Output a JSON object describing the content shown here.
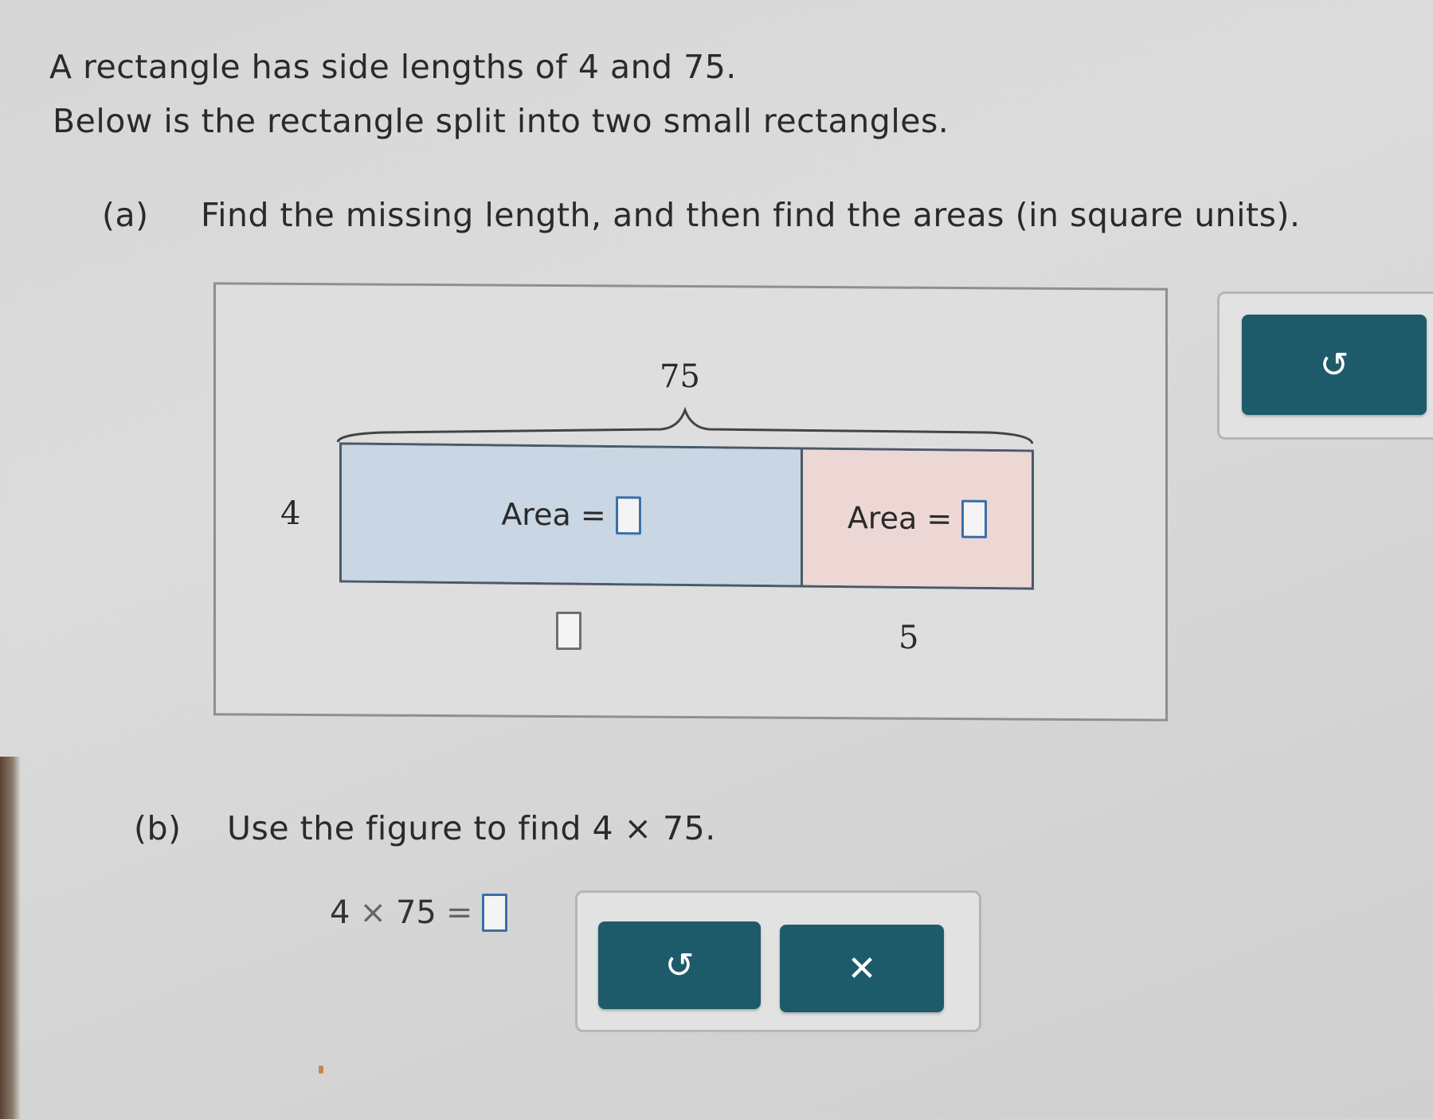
{
  "problem": {
    "line1": "A rectangle has side lengths of 4 and 75.",
    "line2": "Below is the rectangle split into two small rectangles.",
    "part_a": {
      "label": "(a)",
      "text": "Find the missing length, and then find the areas (in square units)."
    },
    "part_b": {
      "label": "(b)",
      "text": "Use the figure to find 4 × 75."
    }
  },
  "figure": {
    "top_length": "75",
    "side_length": "4",
    "left_area_label": "Area =",
    "right_area_label": "Area =",
    "left_area_value": "",
    "right_area_value": "",
    "missing_length_value": "",
    "right_bottom_length": "5",
    "left_color": "#c9d6e3",
    "right_color": "#ecd7d4"
  },
  "equation": {
    "left": "4",
    "op": "×",
    "right": "75",
    "eq": "=",
    "answer": ""
  },
  "tools": {
    "undo_icon": "undo-icon",
    "undo_glyph": "↺",
    "clear_icon": "close-icon",
    "clear_glyph": "✕",
    "button_color": "#1e5b6a"
  }
}
